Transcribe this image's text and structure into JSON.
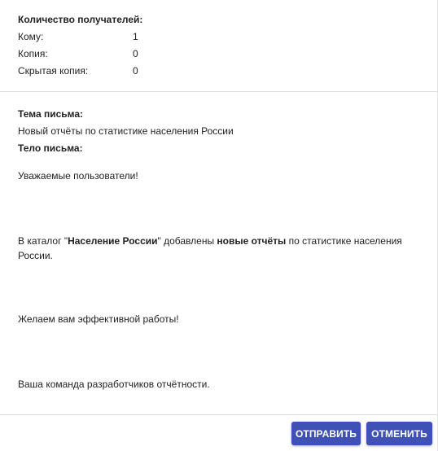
{
  "recipients": {
    "title": "Количество получателей:",
    "rows": [
      {
        "label": "Кому:",
        "value": "1"
      },
      {
        "label": "Копия:",
        "value": "0"
      },
      {
        "label": "Скрытая копия:",
        "value": "0"
      }
    ]
  },
  "mail": {
    "subject_title": "Тема письма:",
    "subject_value": "Новый отчёты по статистике населения России",
    "body_title": "Тело письма:",
    "greeting": "Уважаемые пользователи!",
    "p2_part1": "В каталог \"",
    "p2_bold1": "Население России",
    "p2_part2": "\" добавлены ",
    "p2_bold2": "новые отчёты",
    "p2_part3": " по статистике населения России.",
    "wish": "Желаем вам эффективной работы!",
    "signature": "Ваша команда разработчиков отчётности."
  },
  "buttons": {
    "send": "ОТПРАВИТЬ",
    "cancel": "ОТМЕНИТЬ"
  },
  "colors": {
    "accent": "#3f51b5"
  }
}
